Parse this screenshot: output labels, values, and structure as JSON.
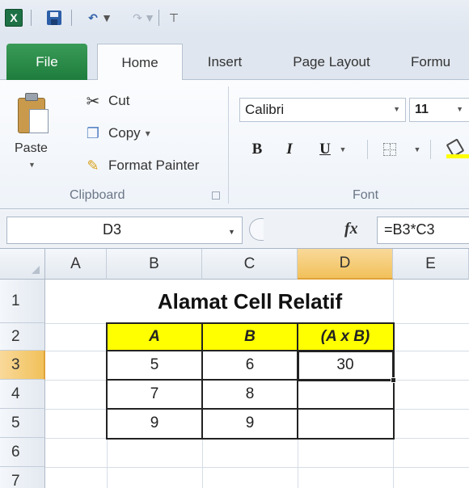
{
  "quick_access": {
    "app_icon": "excel-icon",
    "app_icon_letter": "X",
    "save_icon": "save-icon",
    "undo_icon": "undo-icon",
    "redo_icon": "redo-icon",
    "customize_icon": "customize-icon",
    "undo_glyph": "↶",
    "redo_glyph": "↷",
    "dropdown_glyph": "▼",
    "customize_glyph": "⊤"
  },
  "tabs": [
    {
      "label": "File"
    },
    {
      "label": "Home"
    },
    {
      "label": "Insert"
    },
    {
      "label": "Page Layout"
    },
    {
      "label": "Formu"
    }
  ],
  "ribbon": {
    "clipboard": {
      "paste_label": "Paste",
      "cut_label": "Cut",
      "copy_label": "Copy",
      "copy_dd": "▾",
      "format_painter_label": "Format Painter",
      "group_label": "Clipboard",
      "cut_glyph": "✂",
      "copy_glyph": "❐",
      "fp_glyph": "✎"
    },
    "font": {
      "font_name": "Calibri",
      "font_size": "11",
      "bold": "B",
      "italic": "I",
      "underline": "U",
      "group_label": "Font"
    },
    "colors": {
      "fill_color": "#ffff00",
      "file_tab": "#2a8a48"
    }
  },
  "formula_bar": {
    "name_box": "D3",
    "fx": "fx",
    "formula": "=B3*C3"
  },
  "grid": {
    "columns": [
      "A",
      "B",
      "C",
      "D",
      "E"
    ],
    "active_column": "D",
    "rows": [
      "1",
      "2",
      "3",
      "4",
      "5",
      "6",
      "7"
    ],
    "active_row": "3",
    "title": "Alamat Cell Relatif",
    "headers": [
      "A",
      "B",
      "(A x B)"
    ],
    "data": [
      [
        "5",
        "6",
        "30"
      ],
      [
        "7",
        "8",
        ""
      ],
      [
        "9",
        "9",
        ""
      ]
    ]
  }
}
